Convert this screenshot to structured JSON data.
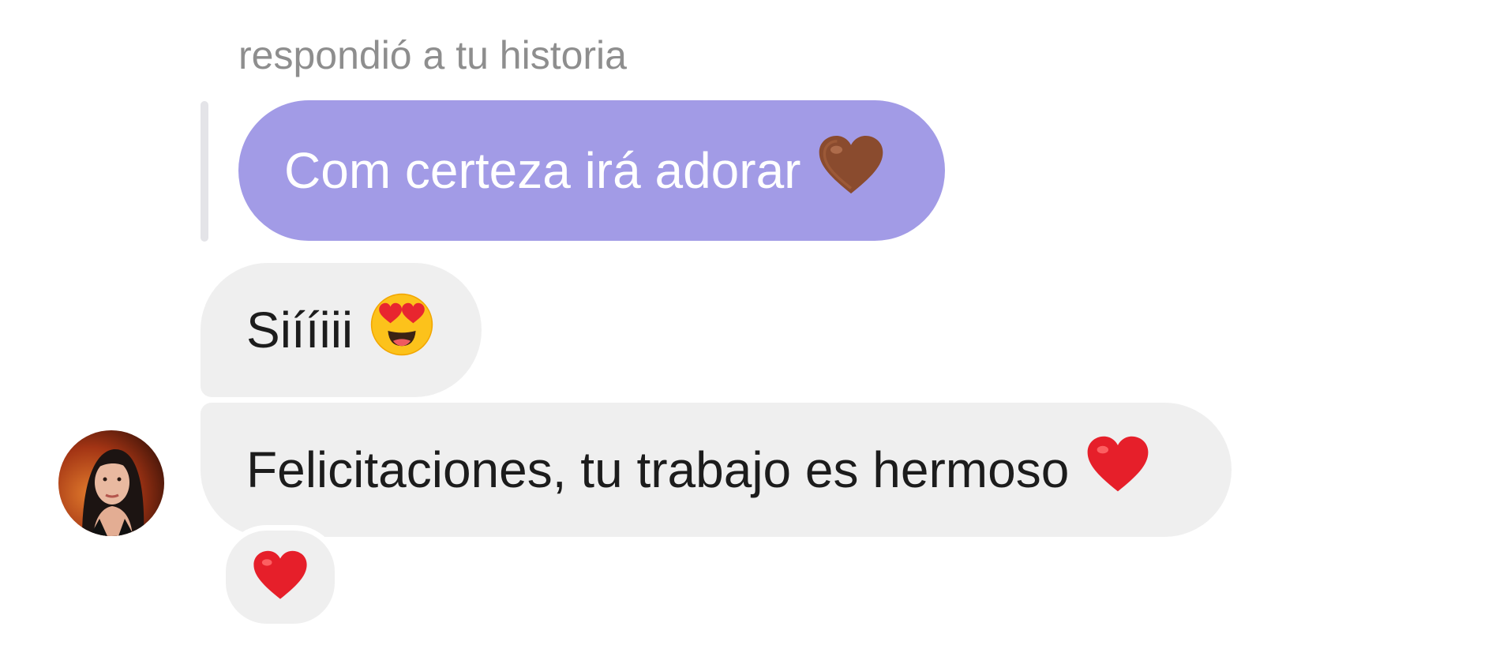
{
  "thread": {
    "story_reply_caption": "respondió a tu historia",
    "quoted_message": {
      "text": "Com certeza irá adorar",
      "emoji": "brown-heart-icon",
      "bubble_color": "#a29be6"
    },
    "messages": [
      {
        "text": "Siííiii",
        "emoji": "heart-eyes-face-icon"
      },
      {
        "text": "Felicitaciones, tu trabajo es hermoso",
        "emoji": "red-heart-icon"
      }
    ],
    "reaction": {
      "emoji": "red-heart-icon"
    },
    "incoming_bubble_color": "#efefef"
  }
}
